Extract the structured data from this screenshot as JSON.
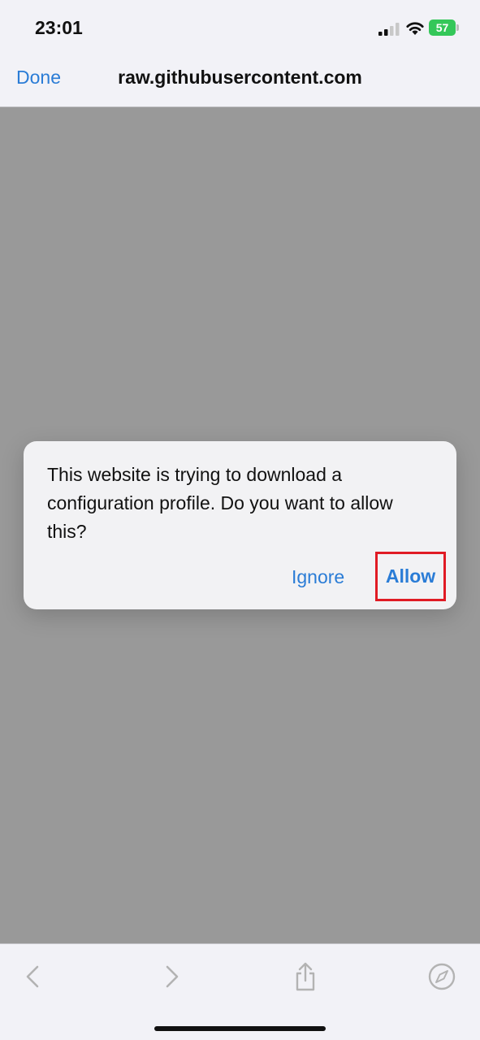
{
  "status_bar": {
    "time": "23:01",
    "battery_level": "57",
    "icons": [
      "signal-icon",
      "wifi-icon",
      "battery-icon"
    ]
  },
  "nav": {
    "done_label": "Done",
    "title": "raw.githubusercontent.com"
  },
  "alert": {
    "message": "This website is trying to download a configuration profile. Do you want to allow this?",
    "ignore_label": "Ignore",
    "allow_label": "Allow"
  },
  "toolbar": {
    "icons": [
      "back-icon",
      "forward-icon",
      "share-icon",
      "compass-icon"
    ]
  },
  "colors": {
    "accent": "#2a7cd6",
    "highlight": "#e01b24",
    "dim_background": "#999999"
  }
}
